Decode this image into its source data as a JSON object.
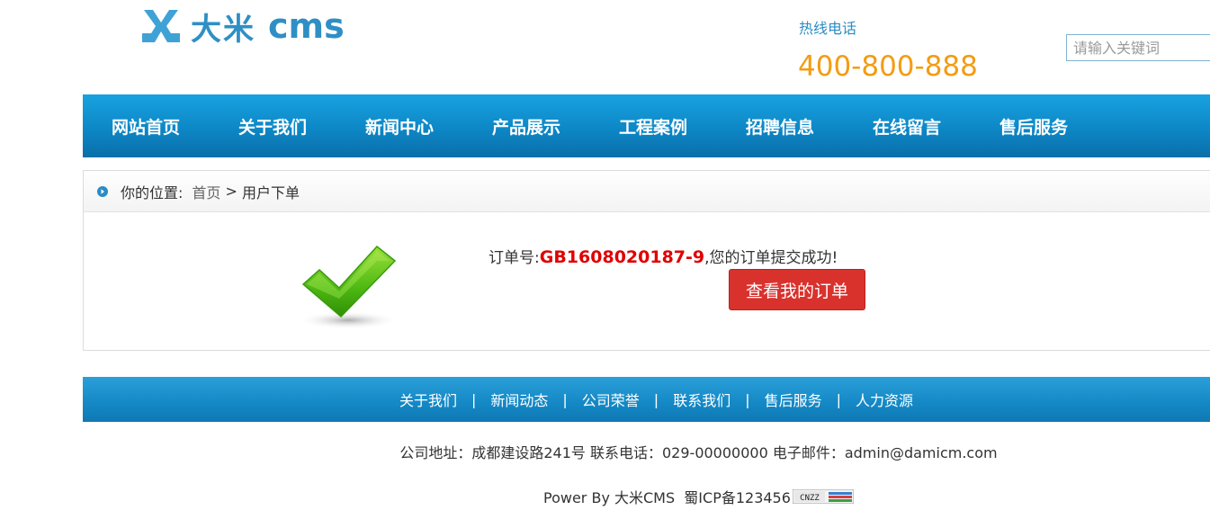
{
  "header": {
    "logo_cn": "大米",
    "logo_en": "cms",
    "hotline_label": "热线电话",
    "hotline_number": "400-800-888",
    "search_placeholder": "请输入关键词"
  },
  "nav": {
    "items": [
      "网站首页",
      "关于我们",
      "新闻中心",
      "产品展示",
      "工程案例",
      "招聘信息",
      "在线留言",
      "售后服务"
    ]
  },
  "breadcrumb": {
    "prefix": "你的位置:",
    "home": "首页",
    "separator": " > ",
    "current": "用户下单"
  },
  "order": {
    "label": "订单号:",
    "number": "GB1608020187-9",
    "message": ",您的订单提交成功!",
    "button_label": "查看我的订单"
  },
  "footer": {
    "links": [
      "关于我们",
      "新闻动态",
      "公司荣誉",
      "联系我们",
      "售后服务",
      "人力资源"
    ],
    "separator": "|",
    "address": "公司地址：成都建设路241号 联系电话：029-00000000 电子邮件：admin@damicm.com",
    "powered": "Power By 大米CMS  蜀ICP备123456",
    "badge_text": "CNZZ"
  },
  "colors": {
    "brand": "#2f8fc5",
    "hotline": "#f39c12",
    "order_number": "#e00000",
    "button": "#d9322d"
  }
}
